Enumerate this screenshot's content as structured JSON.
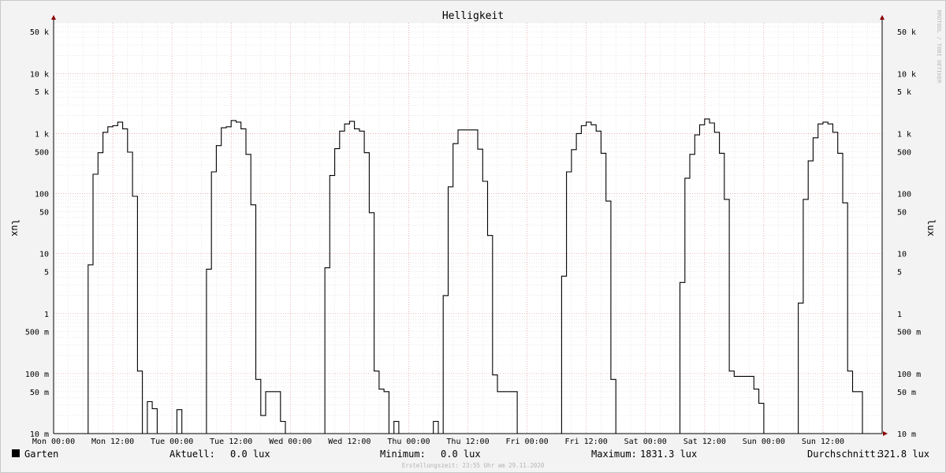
{
  "chart_data": {
    "type": "line",
    "title": "Helligkeit",
    "ylabel": "lux",
    "y_scale": "log",
    "ylim": [
      0.01,
      70000
    ],
    "y_ticks": [
      {
        "value": 0.01,
        "label": "10 m"
      },
      {
        "value": 0.05,
        "label": "50 m"
      },
      {
        "value": 0.1,
        "label": "100 m"
      },
      {
        "value": 0.5,
        "label": "500 m"
      },
      {
        "value": 1,
        "label": "1"
      },
      {
        "value": 5,
        "label": "5"
      },
      {
        "value": 10,
        "label": "10"
      },
      {
        "value": 50,
        "label": "50"
      },
      {
        "value": 100,
        "label": "100"
      },
      {
        "value": 500,
        "label": "500"
      },
      {
        "value": 1000,
        "label": "1 k"
      },
      {
        "value": 5000,
        "label": "5 k"
      },
      {
        "value": 10000,
        "label": "10 k"
      },
      {
        "value": 50000,
        "label": "50 k"
      }
    ],
    "x_ticks": [
      "Mon 00:00",
      "Mon 12:00",
      "Tue 00:00",
      "Tue 12:00",
      "Wed 00:00",
      "Wed 12:00",
      "Thu 00:00",
      "Thu 12:00",
      "Fri 00:00",
      "Fri 12:00",
      "Sat 00:00",
      "Sat 12:00",
      "Sun 00:00",
      "Sun 12:00"
    ],
    "x_unit": "hours since Mon 00:00",
    "xlim": [
      0,
      168
    ],
    "grid": true,
    "series": [
      {
        "name": "Garten",
        "color": "#000000",
        "points": [
          [
            0,
            0.01
          ],
          [
            7,
            0.01
          ],
          [
            7,
            6.5
          ],
          [
            8,
            6.5
          ],
          [
            8,
            210
          ],
          [
            9,
            210
          ],
          [
            9,
            480
          ],
          [
            10,
            480
          ],
          [
            10,
            1050
          ],
          [
            11,
            1050
          ],
          [
            11,
            1300
          ],
          [
            12,
            1300
          ],
          [
            12,
            1350
          ],
          [
            13,
            1350
          ],
          [
            13,
            1550
          ],
          [
            14,
            1550
          ],
          [
            14,
            1200
          ],
          [
            15,
            1200
          ],
          [
            15,
            490
          ],
          [
            16,
            490
          ],
          [
            16,
            90
          ],
          [
            17,
            90
          ],
          [
            17,
            0.11
          ],
          [
            18,
            0.11
          ],
          [
            18,
            0.01
          ],
          [
            19,
            0.01
          ],
          [
            19,
            0.034
          ],
          [
            20,
            0.034
          ],
          [
            20,
            0.026
          ],
          [
            21,
            0.026
          ],
          [
            21,
            0.01
          ],
          [
            25,
            0.01
          ],
          [
            25,
            0.025
          ],
          [
            26,
            0.025
          ],
          [
            26,
            0.01
          ],
          [
            31,
            0.01
          ],
          [
            31,
            5.5
          ],
          [
            32,
            5.5
          ],
          [
            32,
            230
          ],
          [
            33,
            230
          ],
          [
            33,
            630
          ],
          [
            34,
            630
          ],
          [
            34,
            1250
          ],
          [
            35,
            1250
          ],
          [
            35,
            1300
          ],
          [
            36,
            1300
          ],
          [
            36,
            1650
          ],
          [
            37,
            1650
          ],
          [
            37,
            1550
          ],
          [
            38,
            1550
          ],
          [
            38,
            1200
          ],
          [
            39,
            1200
          ],
          [
            39,
            450
          ],
          [
            40,
            450
          ],
          [
            40,
            65
          ],
          [
            41,
            65
          ],
          [
            41,
            0.08
          ],
          [
            42,
            0.08
          ],
          [
            42,
            0.02
          ],
          [
            43,
            0.02
          ],
          [
            43,
            0.05
          ],
          [
            46,
            0.05
          ],
          [
            46,
            0.016
          ],
          [
            47,
            0.016
          ],
          [
            47,
            0.01
          ],
          [
            55,
            0.01
          ],
          [
            55,
            5.8
          ],
          [
            56,
            5.8
          ],
          [
            56,
            200
          ],
          [
            57,
            200
          ],
          [
            57,
            560
          ],
          [
            58,
            560
          ],
          [
            58,
            1100
          ],
          [
            59,
            1100
          ],
          [
            59,
            1450
          ],
          [
            60,
            1450
          ],
          [
            60,
            1600
          ],
          [
            61,
            1600
          ],
          [
            61,
            1200
          ],
          [
            62,
            1200
          ],
          [
            62,
            1100
          ],
          [
            63,
            1100
          ],
          [
            63,
            480
          ],
          [
            64,
            480
          ],
          [
            64,
            48
          ],
          [
            65,
            48
          ],
          [
            65,
            0.11
          ],
          [
            66,
            0.11
          ],
          [
            66,
            0.055
          ],
          [
            67,
            0.055
          ],
          [
            67,
            0.05
          ],
          [
            68,
            0.05
          ],
          [
            68,
            0.01
          ],
          [
            69,
            0.01
          ],
          [
            69,
            0.016
          ],
          [
            70,
            0.016
          ],
          [
            70,
            0.01
          ],
          [
            77,
            0.01
          ],
          [
            77,
            0.016
          ],
          [
            78,
            0.016
          ],
          [
            78,
            0.01
          ],
          [
            79,
            0.01
          ],
          [
            79,
            2
          ],
          [
            80,
            2
          ],
          [
            80,
            130
          ],
          [
            81,
            130
          ],
          [
            81,
            680
          ],
          [
            82,
            680
          ],
          [
            82,
            1150
          ],
          [
            86,
            1150
          ],
          [
            86,
            550
          ],
          [
            87,
            550
          ],
          [
            87,
            160
          ],
          [
            88,
            160
          ],
          [
            88,
            20
          ],
          [
            89,
            20
          ],
          [
            89,
            0.095
          ],
          [
            90,
            0.095
          ],
          [
            90,
            0.05
          ],
          [
            94,
            0.05
          ],
          [
            94,
            0.01
          ],
          [
            103,
            0.01
          ],
          [
            103,
            4.2
          ],
          [
            104,
            4.2
          ],
          [
            104,
            230
          ],
          [
            105,
            230
          ],
          [
            105,
            540
          ],
          [
            106,
            540
          ],
          [
            106,
            1000
          ],
          [
            107,
            1000
          ],
          [
            107,
            1350
          ],
          [
            108,
            1350
          ],
          [
            108,
            1550
          ],
          [
            109,
            1550
          ],
          [
            109,
            1400
          ],
          [
            110,
            1400
          ],
          [
            110,
            1100
          ],
          [
            111,
            1100
          ],
          [
            111,
            470
          ],
          [
            112,
            470
          ],
          [
            112,
            75
          ],
          [
            113,
            75
          ],
          [
            113,
            0.08
          ],
          [
            114,
            0.08
          ],
          [
            114,
            0.01
          ],
          [
            127,
            0.01
          ],
          [
            127,
            3.3
          ],
          [
            128,
            3.3
          ],
          [
            128,
            180
          ],
          [
            129,
            180
          ],
          [
            129,
            450
          ],
          [
            130,
            450
          ],
          [
            130,
            950
          ],
          [
            131,
            950
          ],
          [
            131,
            1400
          ],
          [
            132,
            1400
          ],
          [
            132,
            1750
          ],
          [
            133,
            1750
          ],
          [
            133,
            1500
          ],
          [
            134,
            1500
          ],
          [
            134,
            1050
          ],
          [
            135,
            1050
          ],
          [
            135,
            470
          ],
          [
            136,
            470
          ],
          [
            136,
            80
          ],
          [
            137,
            80
          ],
          [
            137,
            0.11
          ],
          [
            138,
            0.11
          ],
          [
            138,
            0.09
          ],
          [
            142,
            0.09
          ],
          [
            142,
            0.055
          ],
          [
            143,
            0.055
          ],
          [
            143,
            0.032
          ],
          [
            144,
            0.032
          ],
          [
            144,
            0.01
          ],
          [
            151,
            0.01
          ],
          [
            151,
            1.5
          ],
          [
            152,
            1.5
          ],
          [
            152,
            80
          ],
          [
            153,
            80
          ],
          [
            153,
            350
          ],
          [
            154,
            350
          ],
          [
            154,
            850
          ],
          [
            155,
            850
          ],
          [
            155,
            1450
          ],
          [
            156,
            1450
          ],
          [
            156,
            1550
          ],
          [
            157,
            1550
          ],
          [
            157,
            1450
          ],
          [
            158,
            1450
          ],
          [
            158,
            1050
          ],
          [
            159,
            1050
          ],
          [
            159,
            470
          ],
          [
            160,
            470
          ],
          [
            160,
            70
          ],
          [
            161,
            70
          ],
          [
            161,
            0.11
          ],
          [
            162,
            0.11
          ],
          [
            162,
            0.05
          ],
          [
            164,
            0.05
          ],
          [
            164,
            0.01
          ],
          [
            168,
            0.01
          ]
        ]
      }
    ]
  },
  "legend": {
    "series_name": "Garten",
    "swatch_color": "#000000",
    "current_label": "Aktuell:",
    "current_value": "0.0 lux",
    "min_label": "Minimum:",
    "min_value": "0.0 lux",
    "max_label": "Maximum:",
    "max_value": "1831.3 lux",
    "avg_label": "Durchschnitt:",
    "avg_value": "321.8 lux"
  },
  "footer": "Erstellungszeit: 23:55 Uhr am 29.11.2020",
  "watermark": "RRDTOOL / TOBI OETIKER",
  "colors": {
    "background": "#f3f3f3",
    "plot_background": "#ffffff",
    "major_grid": "#e8a0a0",
    "minor_grid": "#d9d9d9",
    "axis_arrow": "#8b0000"
  }
}
